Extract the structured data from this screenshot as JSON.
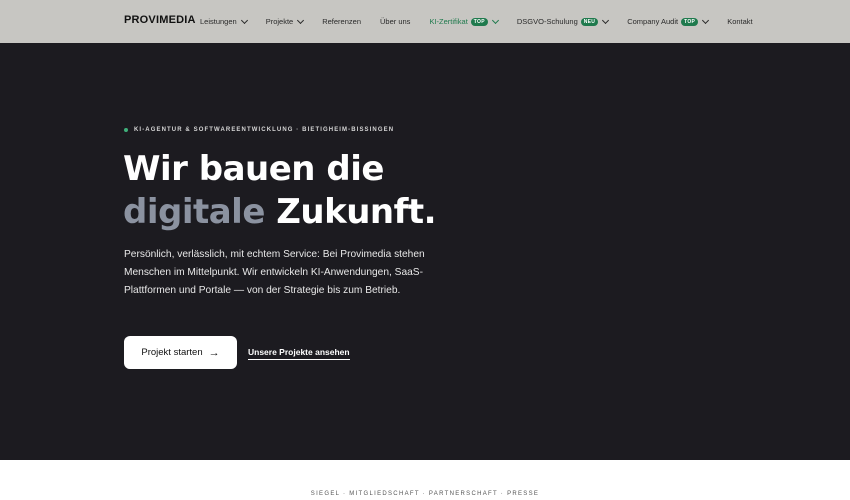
{
  "nav": {
    "logo": "PROVIMEDIA",
    "items": [
      {
        "label": "Leistungen",
        "dropdown": true
      },
      {
        "label": "Projekte",
        "dropdown": true
      },
      {
        "label": "Referenzen",
        "dropdown": false
      },
      {
        "label": "Über uns",
        "dropdown": false
      },
      {
        "label": "KI-Zertifikat",
        "badge": "TOP",
        "dropdown": true
      },
      {
        "label": "DSGVO-Schulung",
        "badge": "NEU",
        "dropdown": true
      },
      {
        "label": "Company Audit",
        "badge": "TOP",
        "dropdown": true
      },
      {
        "label": "Kontakt",
        "dropdown": false
      }
    ]
  },
  "hero": {
    "eyebrow": "KI-AGENTUR & SOFTWAREENTWICKLUNG · BIETIGHEIM-BISSINGEN",
    "headline_line1": "Wir bauen die",
    "headline_grey": "digitale",
    "headline_white": "Zukunft.",
    "lead": "Persönlich, verlässlich, mit echtem Service: Bei Provimedia stehen Menschen im Mittelpunkt. Wir entwickeln KI-Anwendungen, SaaS-Plattformen und Portale — von der Strategie bis zum Betrieb.",
    "cta_primary": "Projekt starten",
    "cta_arrow": "→",
    "cta_secondary": "Unsere Projekte ansehen"
  },
  "strip": {
    "text": "SIEGEL · MITGLIEDSCHAFT · PARTNERSCHAFT · PRESSE"
  },
  "colors": {
    "nav_bg": "#c7c6c2",
    "hero_bg": "#1c1b20",
    "accent_green": "#1f7a4d",
    "headline_grey": "#8b92a0"
  }
}
